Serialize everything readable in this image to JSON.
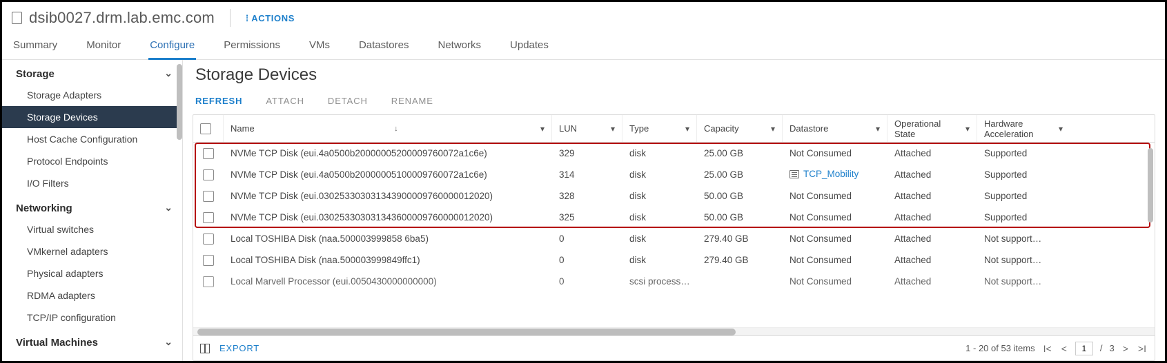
{
  "header": {
    "hostname": "dsib0027.drm.lab.emc.com",
    "actions_label": "ACTIONS"
  },
  "tabs": [
    "Summary",
    "Monitor",
    "Configure",
    "Permissions",
    "VMs",
    "Datastores",
    "Networks",
    "Updates"
  ],
  "active_tab": "Configure",
  "sidebar": {
    "sections": [
      {
        "label": "Storage",
        "items": [
          "Storage Adapters",
          "Storage Devices",
          "Host Cache Configuration",
          "Protocol Endpoints",
          "I/O Filters"
        ],
        "selected": "Storage Devices"
      },
      {
        "label": "Networking",
        "items": [
          "Virtual switches",
          "VMkernel adapters",
          "Physical adapters",
          "RDMA adapters",
          "TCP/IP configuration"
        ]
      },
      {
        "label": "Virtual Machines",
        "items": []
      }
    ]
  },
  "main": {
    "title": "Storage Devices",
    "sub_actions": [
      "REFRESH",
      "ATTACH",
      "DETACH",
      "RENAME"
    ],
    "columns": [
      "Name",
      "LUN",
      "Type",
      "Capacity",
      "Datastore",
      "Operational State",
      "Hardware Acceleration"
    ],
    "rows": [
      {
        "name": "NVMe TCP Disk (eui.4a0500b20000005200009760072a1c6e)",
        "lun": "329",
        "type": "disk",
        "cap": "25.00 GB",
        "ds": "Not Consumed",
        "ds_link": false,
        "op": "Attached",
        "hw": "Supported",
        "hl": true
      },
      {
        "name": "NVMe TCP Disk (eui.4a0500b20000005100009760072a1c6e)",
        "lun": "314",
        "type": "disk",
        "cap": "25.00 GB",
        "ds": "TCP_Mobility",
        "ds_link": true,
        "op": "Attached",
        "hw": "Supported",
        "hl": true
      },
      {
        "name": "NVMe TCP Disk (eui.030253303031343900009760000012020)",
        "lun": "328",
        "type": "disk",
        "cap": "50.00 GB",
        "ds": "Not Consumed",
        "ds_link": false,
        "op": "Attached",
        "hw": "Supported",
        "hl": true
      },
      {
        "name": "NVMe TCP Disk (eui.030253303031343600009760000012020)",
        "lun": "325",
        "type": "disk",
        "cap": "50.00 GB",
        "ds": "Not Consumed",
        "ds_link": false,
        "op": "Attached",
        "hw": "Supported",
        "hl": true
      },
      {
        "name": "Local TOSHIBA Disk (naa.500003999858 6ba5)",
        "lun": "0",
        "type": "disk",
        "cap": "279.40 GB",
        "ds": "Not Consumed",
        "ds_link": false,
        "op": "Attached",
        "hw": "Not support…",
        "hl": false
      },
      {
        "name": "Local TOSHIBA Disk (naa.500003999849ffc1)",
        "lun": "0",
        "type": "disk",
        "cap": "279.40 GB",
        "ds": "Not Consumed",
        "ds_link": false,
        "op": "Attached",
        "hw": "Not support…",
        "hl": false
      },
      {
        "name": "Local Marvell Processor (eui.0050430000000000)",
        "lun": "0",
        "type": "scsi process…",
        "cap": "",
        "ds": "Not Consumed",
        "ds_link": false,
        "op": "Attached",
        "hw": "Not support…",
        "hl": false,
        "cut": true
      }
    ],
    "footer": {
      "export": "EXPORT",
      "summary": "1 - 20 of 53 items",
      "page": "1",
      "pages": "3"
    }
  }
}
